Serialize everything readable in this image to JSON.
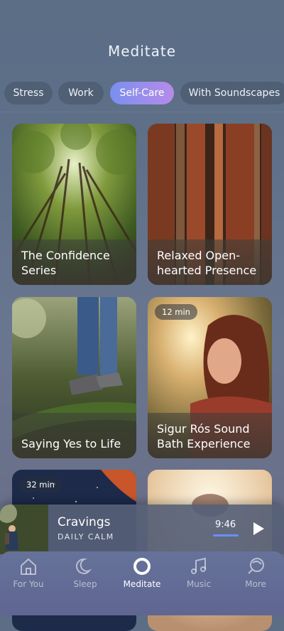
{
  "header": {
    "title": "Meditate"
  },
  "tabs": [
    {
      "label": "Stress",
      "active": false
    },
    {
      "label": "Work",
      "active": false
    },
    {
      "label": "Self-Care",
      "active": true
    },
    {
      "label": "With Soundscapes",
      "active": false
    }
  ],
  "cards": [
    {
      "title": "The Confidence Series",
      "duration": ""
    },
    {
      "title": "Relaxed Open-hearted Presence",
      "duration": ""
    },
    {
      "title": "Saying Yes to Life",
      "duration": ""
    },
    {
      "title": "Sigur Rós Sound Bath Experience",
      "duration": "12 min"
    },
    {
      "title": "",
      "duration": "32 min"
    },
    {
      "title": "",
      "duration": ""
    }
  ],
  "player": {
    "title": "Cravings",
    "subtitle": "DAILY CALM",
    "time": "9:46",
    "progress_percent": 100,
    "play_icon": "play-icon"
  },
  "nav": [
    {
      "label": "For You",
      "icon": "home-icon",
      "active": false
    },
    {
      "label": "Sleep",
      "icon": "moon-icon",
      "active": false
    },
    {
      "label": "Meditate",
      "icon": "meditate-circle-icon",
      "active": true
    },
    {
      "label": "Music",
      "icon": "music-note-icon",
      "active": false
    },
    {
      "label": "More",
      "icon": "more-icon",
      "active": false
    }
  ],
  "colors": {
    "accent_start": "#7a8ff0",
    "accent_end": "#b68ce8",
    "progress": "#6a8ef5"
  }
}
